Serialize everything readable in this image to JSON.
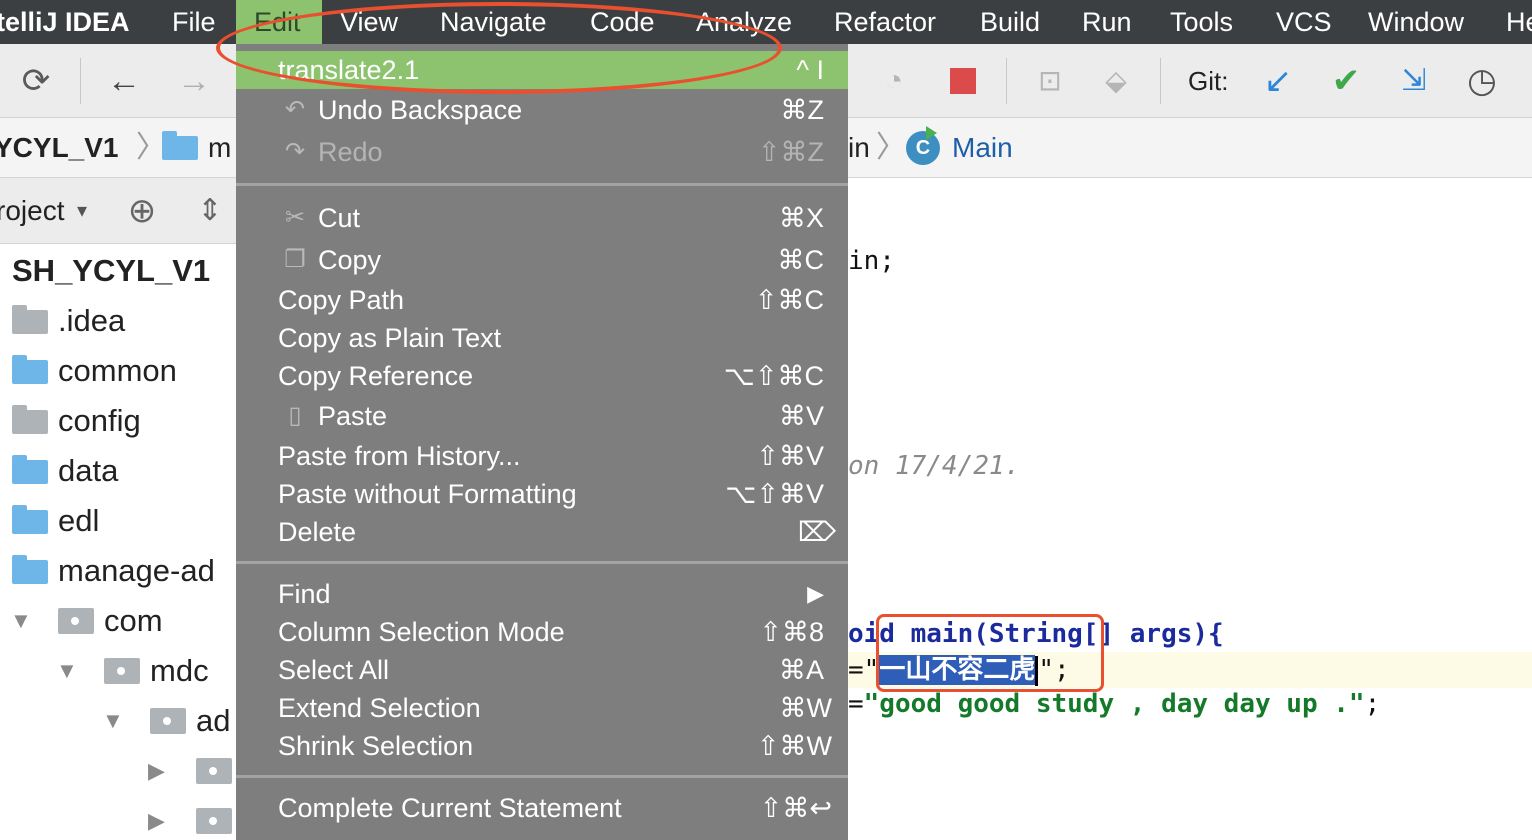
{
  "menubar": {
    "items": [
      "telliJ IDEA",
      "File",
      "Edit",
      "View",
      "Navigate",
      "Code",
      "Analyze",
      "Refactor",
      "Build",
      "Run",
      "Tools",
      "VCS",
      "Window",
      "He"
    ]
  },
  "toolbar": {
    "icons": [
      "sync-icon",
      "back-arrow-icon",
      "forward-arrow-icon",
      "coverage-icon",
      "stop-icon",
      "build-artifact-icon",
      "deploy-icon",
      "git-update-icon",
      "git-commit-icon",
      "git-compare-icon",
      "history-icon"
    ],
    "git_label": "Git:"
  },
  "breadcrumb": {
    "project": "YCYL_V1",
    "folder": "m",
    "module_tail": "in",
    "class_name": "Main"
  },
  "project_panel": {
    "title": "roject",
    "root": "SH_YCYL_V1",
    "items": [
      ".idea",
      "common",
      "config",
      "data",
      "edl",
      "manage-ad",
      "com",
      "mdc",
      "ad"
    ]
  },
  "editor": {
    "line_package_tail": "in;",
    "line_comment_tail": "on 17/4/21.",
    "line_main_sig": "oid main(String[] args){",
    "line_str1_prefix": "=\"",
    "line_str1_selected": "一山不容二虎",
    "line_str1_suffix": "\";",
    "line_str2_prefix": "=",
    "line_str2_literal": "\"good good study , day day up .\"",
    "line_str2_suffix": ";"
  },
  "edit_menu": {
    "highlighted": {
      "label": "translate2.1",
      "shortcut": "^ I"
    },
    "undo": {
      "label": "Undo Backspace",
      "shortcut": "⌘Z"
    },
    "redo": {
      "label": "Redo",
      "shortcut": "⇧⌘Z"
    },
    "cut": {
      "label": "Cut",
      "shortcut": "⌘X"
    },
    "copy": {
      "label": "Copy",
      "shortcut": "⌘C"
    },
    "copy_path": {
      "label": "Copy Path",
      "shortcut": "⇧⌘C"
    },
    "copy_plain": {
      "label": "Copy as Plain Text",
      "shortcut": ""
    },
    "copy_reference": {
      "label": "Copy Reference",
      "shortcut": "⌥⇧⌘C"
    },
    "paste": {
      "label": "Paste",
      "shortcut": "⌘V"
    },
    "paste_history": {
      "label": "Paste from History...",
      "shortcut": "⇧⌘V"
    },
    "paste_no_format": {
      "label": "Paste without Formatting",
      "shortcut": "⌥⇧⌘V"
    },
    "delete": {
      "label": "Delete",
      "shortcut": "⌦"
    },
    "find": {
      "label": "Find",
      "shortcut": "▶"
    },
    "column_mode": {
      "label": "Column Selection Mode",
      "shortcut": "⇧⌘8"
    },
    "select_all": {
      "label": "Select All",
      "shortcut": "⌘A"
    },
    "extend_sel": {
      "label": "Extend Selection",
      "shortcut": "⌘W"
    },
    "shrink_sel": {
      "label": "Shrink Selection",
      "shortcut": "⇧⌘W"
    },
    "complete_stmt": {
      "label": "Complete Current Statement",
      "shortcut": "⇧⌘↩"
    }
  },
  "colors": {
    "menubar_bg": "#3c3f41",
    "menu_highlight": "#8dc36f",
    "dropdown_bg": "#7e7e7e",
    "annotation_red": "#e8502f",
    "selection_blue": "#2f5eb8",
    "string_green": "#147a2a"
  }
}
